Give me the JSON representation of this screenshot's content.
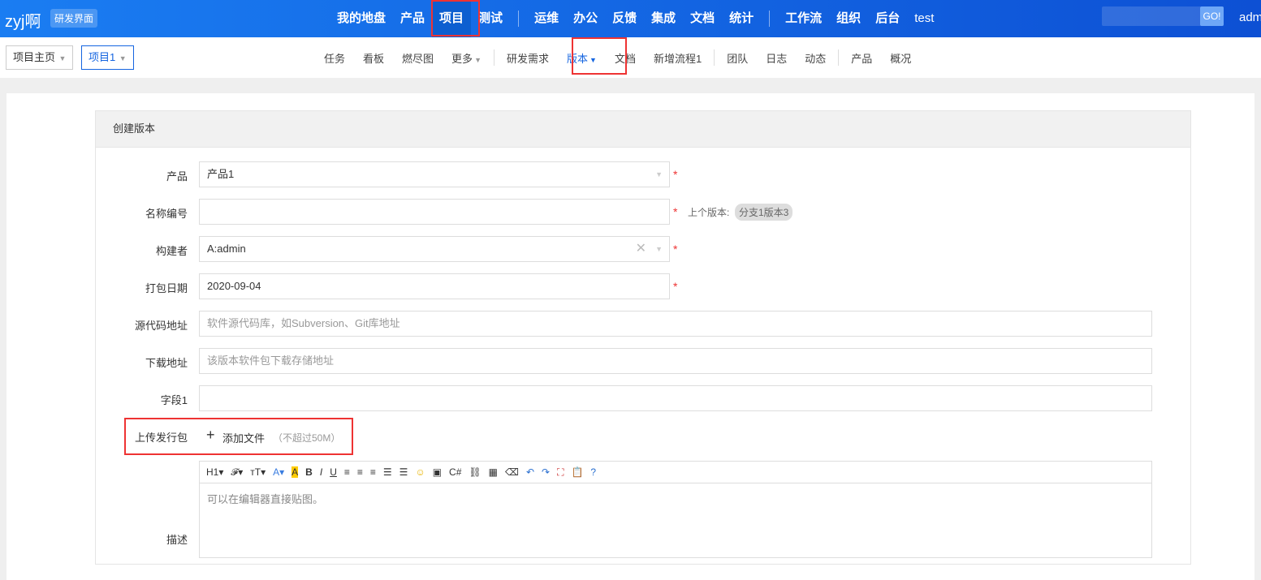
{
  "top": {
    "logo": "zyj啊",
    "badge": "研发界面",
    "nav": [
      "我的地盘",
      "产品",
      "项目",
      "测试",
      "运维",
      "办公",
      "反馈",
      "集成",
      "文档",
      "统计",
      "工作流",
      "组织",
      "后台",
      "test"
    ],
    "active": "项目",
    "go": "GO!",
    "user": "adm"
  },
  "breadcrumb": [
    "项目主页",
    "项目1"
  ],
  "subnav": [
    "任务",
    "看板",
    "燃尽图",
    "更多",
    "研发需求",
    "版本",
    "文档",
    "新增流程1",
    "团队",
    "日志",
    "动态",
    "产品",
    "概况"
  ],
  "form": {
    "title": "创建版本",
    "product": {
      "label": "产品",
      "value": "产品1"
    },
    "name": {
      "label": "名称编号",
      "prev_label": "上个版本:",
      "prev_value": "分支1版本3"
    },
    "builder": {
      "label": "构建者",
      "value": "A:admin"
    },
    "date": {
      "label": "打包日期",
      "value": "2020-09-04"
    },
    "scm": {
      "label": "源代码地址",
      "placeholder": "软件源代码库，如Subversion、Git库地址"
    },
    "download": {
      "label": "下载地址",
      "placeholder": "该版本软件包下载存储地址"
    },
    "field1": {
      "label": "字段1"
    },
    "upload": {
      "label": "上传发行包",
      "button": "添加文件",
      "hint": "（不超过50M）"
    },
    "desc": {
      "label": "描述",
      "placeholder": "可以在编辑器直接贴图。"
    }
  },
  "required_mark": "*",
  "accent": "#1565e0"
}
